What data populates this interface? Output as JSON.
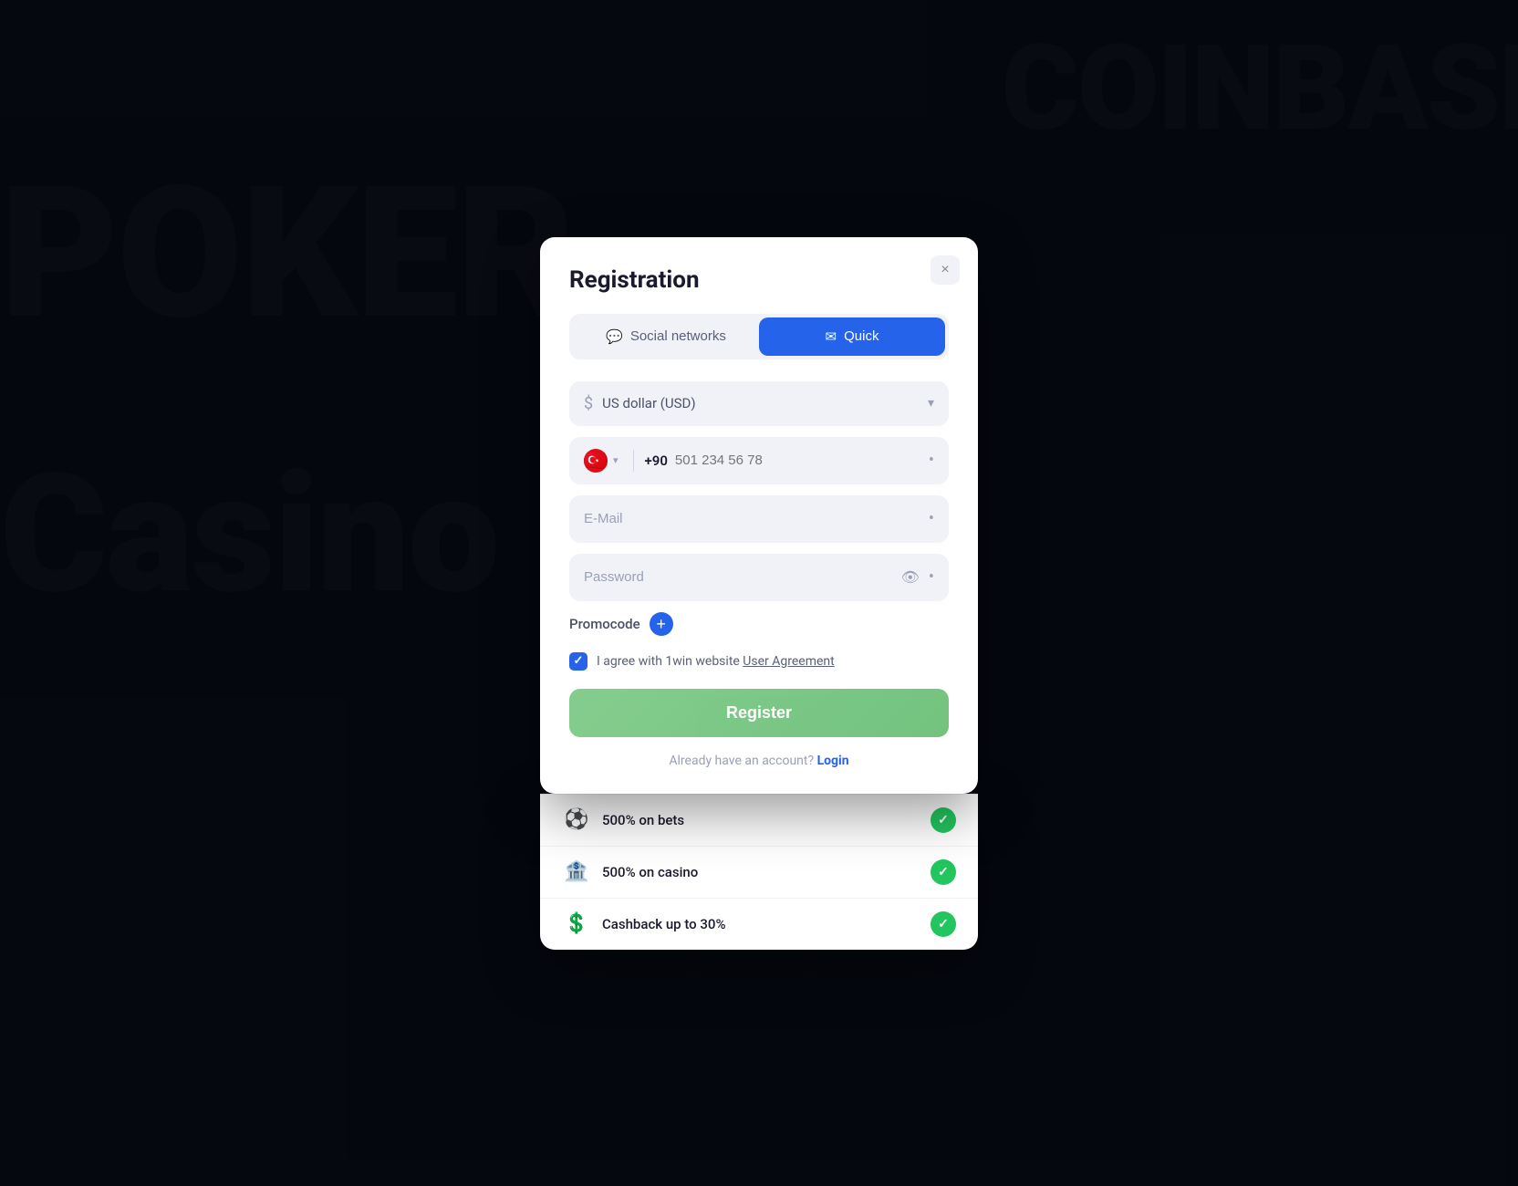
{
  "background": {
    "text_poker": "POKER",
    "text_casino": "Casino",
    "text_top_right": "COINBASE"
  },
  "modal": {
    "title": "Registration",
    "close_label": "×",
    "tabs": [
      {
        "id": "social",
        "label": "Social networks",
        "icon": "💬",
        "active": false
      },
      {
        "id": "quick",
        "label": "Quick",
        "icon": "✉",
        "active": true
      }
    ],
    "currency": {
      "placeholder": "US dollar (USD)",
      "icon": "$"
    },
    "phone": {
      "country_code": "+90",
      "placeholder": "501 234 56 78",
      "flag": "🇹🇷"
    },
    "email": {
      "placeholder": "E-Mail"
    },
    "password": {
      "placeholder": "Password"
    },
    "promocode": {
      "label": "Promocode",
      "add_icon": "+"
    },
    "agreement": {
      "text": "I agree with 1win website ",
      "link_text": "User Agreement"
    },
    "register_button": "Register",
    "login_prompt": "Already have an account?",
    "login_link": "Login"
  },
  "bonuses": [
    {
      "icon": "⚽",
      "text": "500% on bets"
    },
    {
      "icon": "🏦",
      "text": "500% on casino"
    },
    {
      "icon": "💲",
      "text": "Cashback up to 30%"
    }
  ]
}
